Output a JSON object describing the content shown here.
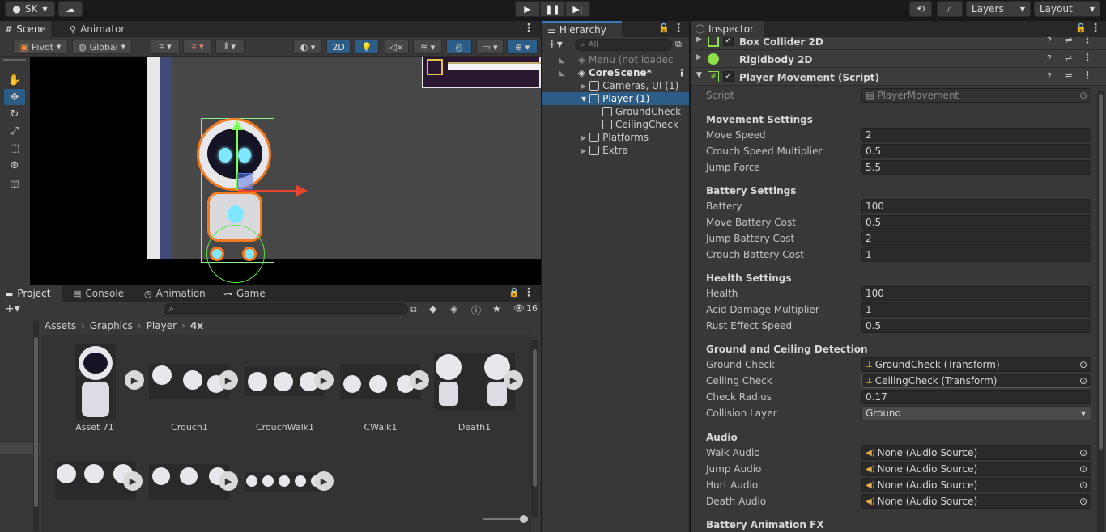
{
  "topbar": {
    "account": "SK",
    "layers": "Layers",
    "layout": "Layout"
  },
  "scene_panel": {
    "tabs": [
      "Scene",
      "Animator"
    ],
    "pivot": "Pivot",
    "global": "Global",
    "mode_2d": "2D"
  },
  "hierarchy": {
    "tab": "Hierarchy",
    "search_placeholder": "All",
    "items": [
      {
        "label": "Menu (not loadec"
      },
      {
        "label": "CoreScene*"
      },
      {
        "label": "Cameras, UI (1)"
      },
      {
        "label": "Player (1)"
      },
      {
        "label": "GroundCheck"
      },
      {
        "label": "CeilingCheck"
      },
      {
        "label": "Platforms"
      },
      {
        "label": "Extra"
      }
    ]
  },
  "project_panel": {
    "tabs": [
      "Project",
      "Console",
      "Animation",
      "Game"
    ],
    "badge_count": "16",
    "breadcrumb": [
      "Assets",
      "Graphics",
      "Player",
      "4x"
    ],
    "assets": [
      "Asset 71",
      "Crouch1",
      "CrouchWalk1",
      "CWalk1",
      "Death1"
    ]
  },
  "inspector": {
    "tab": "Inspector",
    "components": [
      "Box Collider 2D",
      "Rigidbody 2D",
      "Player Movement (Script)"
    ],
    "script_label": "Script",
    "script_value": "PlayerMovement",
    "sections": [
      {
        "title": "Movement Settings",
        "fields": [
          {
            "label": "Move Speed",
            "value": "2"
          },
          {
            "label": "Crouch Speed Multiplier",
            "value": "0.5"
          },
          {
            "label": "Jump Force",
            "value": "5.5"
          }
        ]
      },
      {
        "title": "Battery Settings",
        "fields": [
          {
            "label": "Battery",
            "value": "100"
          },
          {
            "label": "Move Battery Cost",
            "value": "0.5"
          },
          {
            "label": "Jump Battery Cost",
            "value": "2"
          },
          {
            "label": "Crouch Battery Cost",
            "value": "1"
          }
        ]
      },
      {
        "title": "Health Settings",
        "fields": [
          {
            "label": "Health",
            "value": "100"
          },
          {
            "label": "Acid Damage Multiplier",
            "value": "1"
          },
          {
            "label": "Rust Effect Speed",
            "value": "0.5"
          }
        ]
      },
      {
        "title": "Ground and Ceiling Detection",
        "fields": [
          {
            "label": "Ground Check",
            "value": "GroundCheck (Transform)"
          },
          {
            "label": "Ceiling Check",
            "value": "CeilingCheck (Transform)"
          },
          {
            "label": "Check Radius",
            "value": "0.17"
          },
          {
            "label": "Collision Layer",
            "value": "Ground"
          }
        ]
      },
      {
        "title": "Audio",
        "fields": [
          {
            "label": "Walk Audio",
            "value": "None (Audio Source)"
          },
          {
            "label": "Jump Audio",
            "value": "None (Audio Source)"
          },
          {
            "label": "Hurt Audio",
            "value": "None (Audio Source)"
          },
          {
            "label": "Death Audio",
            "value": "None (Audio Source)"
          }
        ]
      }
    ],
    "trailing_header": "Battery Animation FX"
  },
  "colors": {
    "accent_blue": "#2c5d87",
    "orange_outline": "#f47a20",
    "green_collider": "#7cff56",
    "component_check_green": "#8ee04a"
  }
}
